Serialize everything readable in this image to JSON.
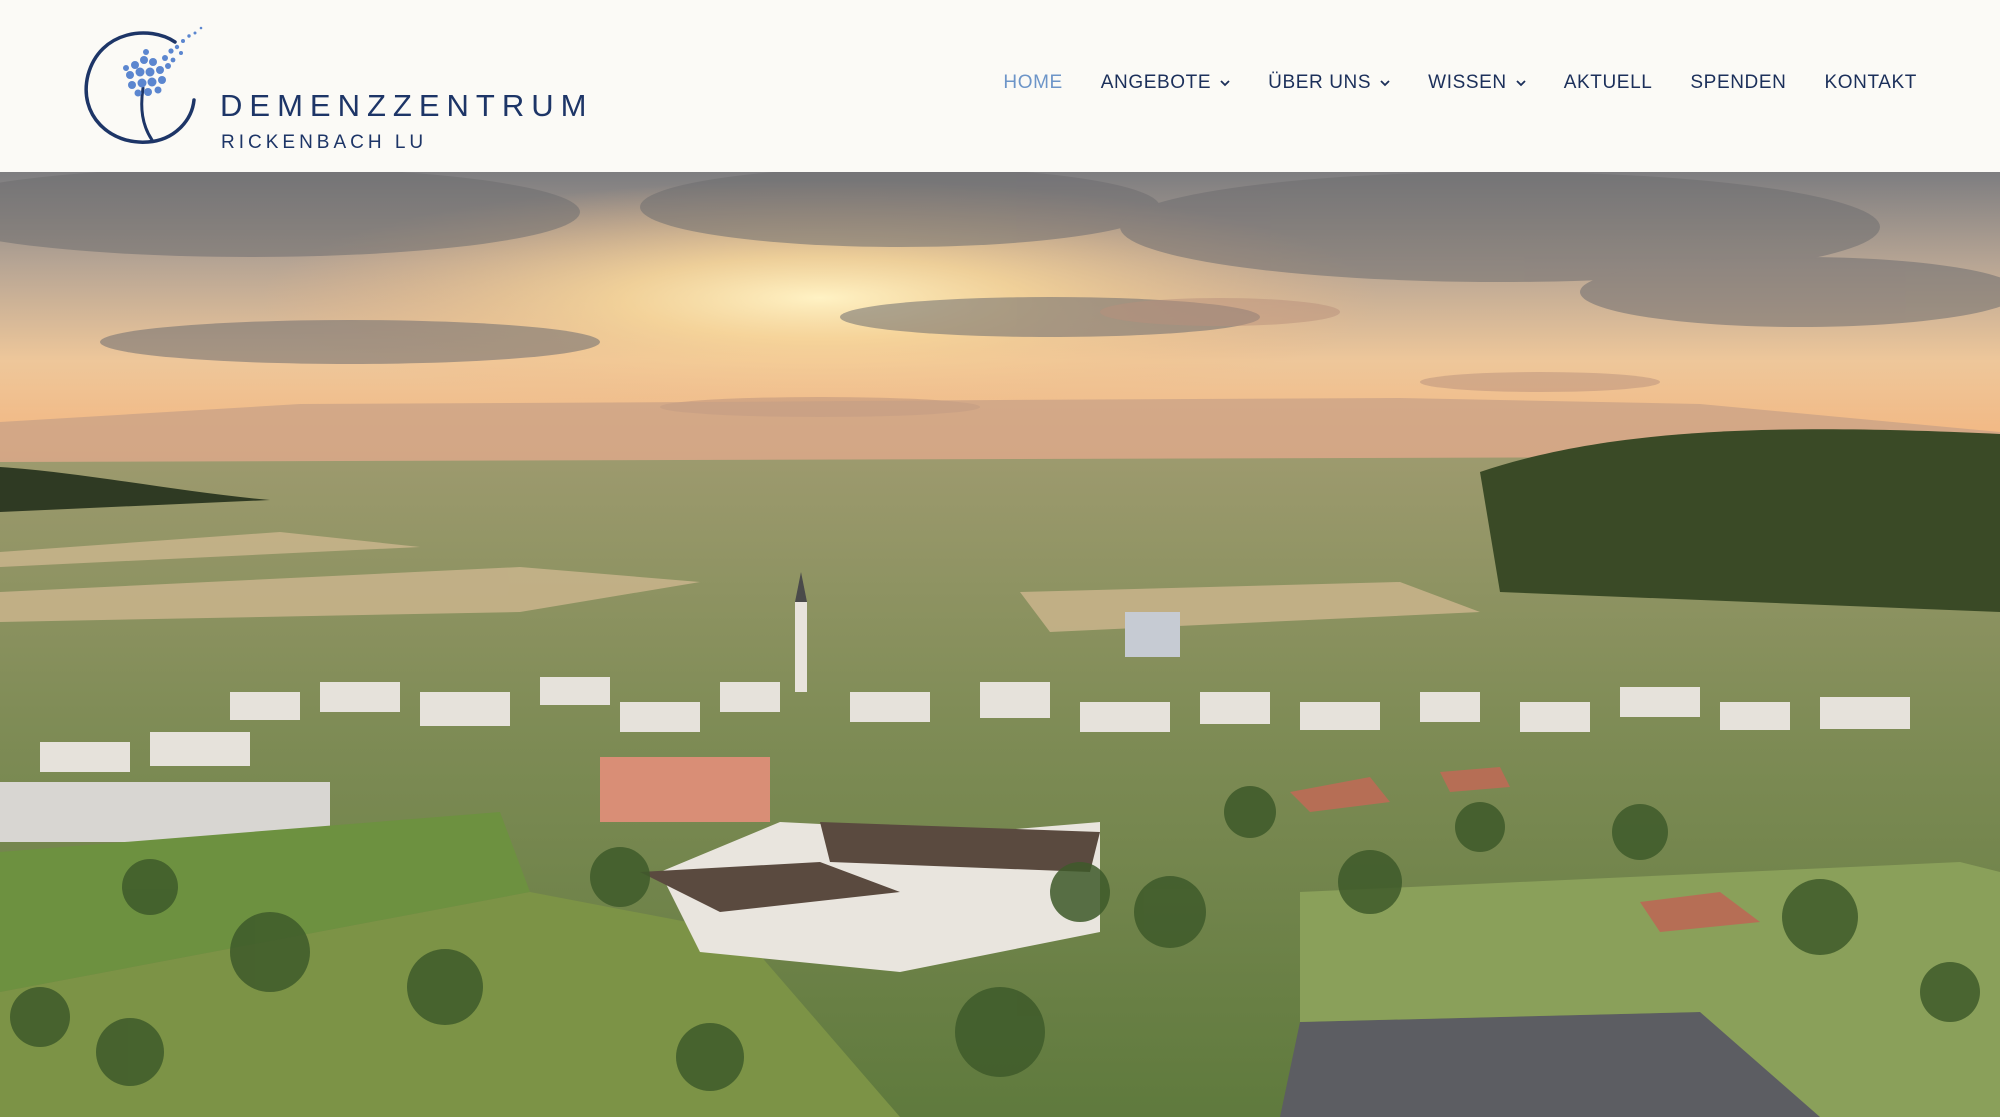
{
  "brand": {
    "title": "DEMENZZENTRUM",
    "subtitle": "RICKENBACH LU",
    "logo_icon": "dandelion-circle-logo-icon"
  },
  "nav": {
    "items": [
      {
        "label": "HOME",
        "active": true,
        "has_dropdown": false
      },
      {
        "label": "ANGEBOTE",
        "active": false,
        "has_dropdown": true
      },
      {
        "label": "ÜBER UNS",
        "active": false,
        "has_dropdown": true
      },
      {
        "label": "WISSEN",
        "active": false,
        "has_dropdown": true
      },
      {
        "label": "AKTUELL",
        "active": false,
        "has_dropdown": false
      },
      {
        "label": "SPENDEN",
        "active": false,
        "has_dropdown": false
      },
      {
        "label": "KONTAKT",
        "active": false,
        "has_dropdown": false
      }
    ]
  },
  "colors": {
    "brand_navy": "#1d3567",
    "nav_active": "#6d95c8",
    "logo_dots": "#5b86cf",
    "header_bg": "#fbfaf6"
  }
}
